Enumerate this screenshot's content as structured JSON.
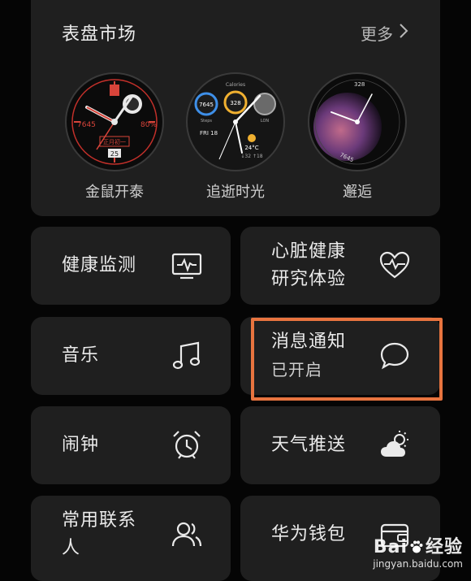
{
  "market": {
    "title": "表盘市场",
    "more_label": "更多",
    "faces": [
      {
        "label": "金鼠开泰",
        "steps": "7645",
        "battery": "80%",
        "date": "正月初一",
        "day": "25"
      },
      {
        "label": "追逝时光",
        "top_label": "Calories",
        "steps_value": "7645",
        "calories_value": "328",
        "steps_label": "Steps",
        "lon_label": "LON",
        "date_text": "FRI  18",
        "temp": "24°C",
        "temp_range": "↓32  ↑18"
      },
      {
        "label": "邂逅",
        "top_value": "328",
        "bottom_value": "7645"
      }
    ]
  },
  "tiles": {
    "health_monitor": "健康监测",
    "heart_health_line1": "心脏健康",
    "heart_health_line2": "研究体验",
    "music": "音乐",
    "notifications": "消息通知",
    "notifications_status": "已开启",
    "alarm": "闹钟",
    "weather_push": "天气推送",
    "contacts_line1": "常用联系",
    "contacts_line2": "人",
    "wallet": "华为钱包"
  },
  "watermark": {
    "brand": "Bai",
    "brand_suffix": "经验",
    "url": "jingyan.baidu.com"
  },
  "colors": {
    "card_bg": "#1f1f1f",
    "page_bg": "#050505",
    "highlight": "#e8743f"
  }
}
